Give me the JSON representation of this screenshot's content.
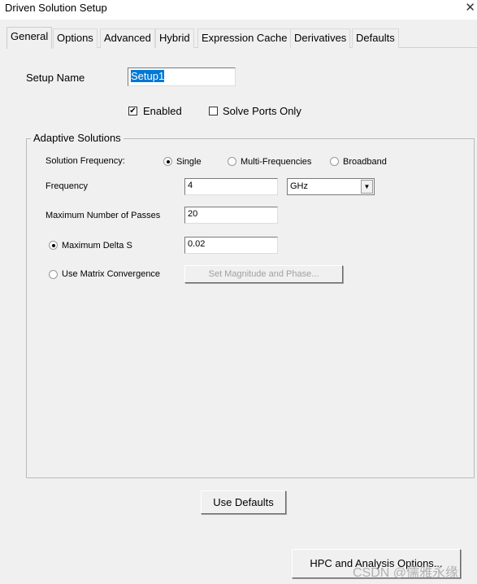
{
  "window": {
    "title": "Driven Solution Setup",
    "close_icon": "close-icon"
  },
  "tabs": [
    "General",
    "Options",
    "Advanced",
    "Hybrid",
    "Expression Cache",
    "Derivatives",
    "Defaults"
  ],
  "active_tab": "General",
  "setup_name": {
    "label": "Setup Name",
    "value": "Setup1"
  },
  "enabled": {
    "label": "Enabled",
    "checked": true
  },
  "solve_ports_only": {
    "label": "Solve Ports Only",
    "checked": false
  },
  "adaptive": {
    "title": "Adaptive Solutions",
    "solution_frequency_label": "Solution Frequency:",
    "freq_options": [
      "Single",
      "Multi-Frequencies",
      "Broadband"
    ],
    "selected_freq_option": "Single",
    "frequency_label": "Frequency",
    "frequency_value": "4",
    "frequency_unit": "GHz",
    "max_passes_label": "Maximum Number of Passes",
    "max_passes_value": "20",
    "max_delta_s_label": "Maximum Delta S",
    "max_delta_s_value": "0.02",
    "max_delta_s_selected": true,
    "matrix_conv_label": "Use Matrix Convergence",
    "matrix_conv_selected": false,
    "set_mag_phase_label": "Set Magnitude and Phase..."
  },
  "use_defaults_label": "Use Defaults",
  "hpc_label": "HPC and Analysis Options...",
  "watermark": "CSDN @儒雅永缘"
}
